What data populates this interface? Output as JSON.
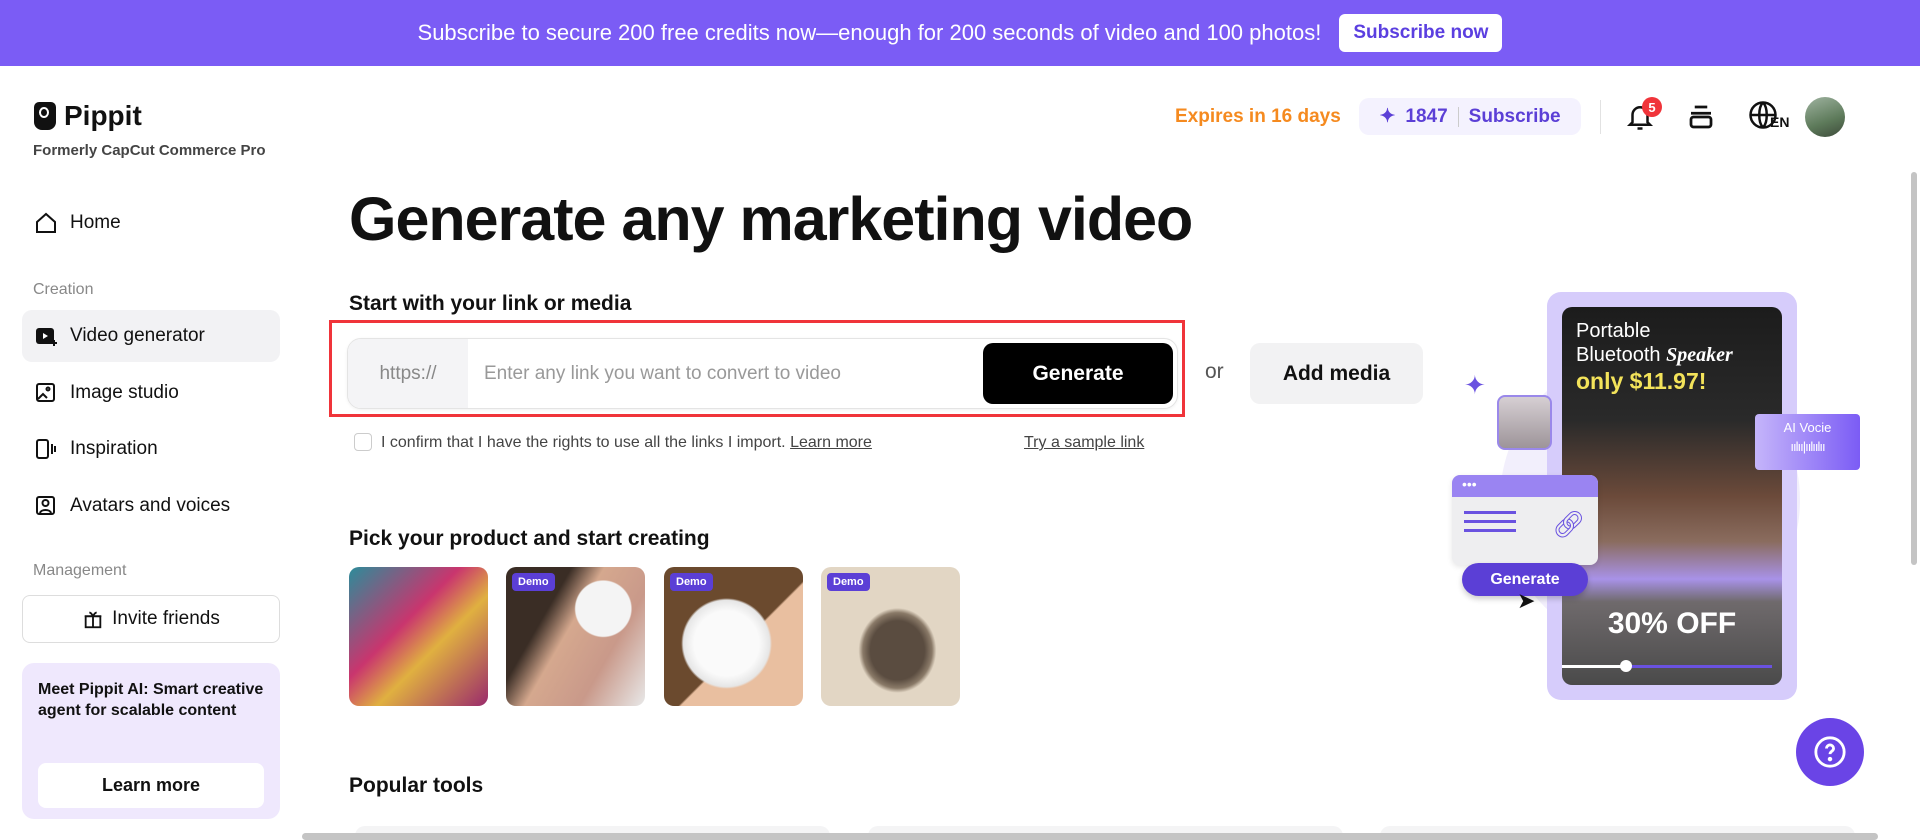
{
  "banner": {
    "text": "Subscribe to secure 200 free credits now—enough for 200 seconds of video and 100 photos!",
    "button": "Subscribe now"
  },
  "brand": {
    "name": "Pippit",
    "subtitle": "Formerly CapCut Commerce Pro"
  },
  "header": {
    "expires": "Expires in 16 days",
    "credits": "1847",
    "subscribe": "Subscribe",
    "notifications": "5",
    "language": "EN"
  },
  "sidebar": {
    "home": "Home",
    "creation_label": "Creation",
    "items": [
      {
        "label": "Video generator"
      },
      {
        "label": "Image studio"
      },
      {
        "label": "Inspiration"
      },
      {
        "label": "Avatars and voices"
      }
    ],
    "management_label": "Management",
    "invite": "Invite friends",
    "promo": {
      "text": "Meet Pippit AI: Smart creative agent for scalable content",
      "button": "Learn more"
    }
  },
  "main": {
    "title": "Generate any marketing video",
    "link_section": "Start with your link or media",
    "prefix": "https://",
    "placeholder": "Enter any link you want to convert to video",
    "generate": "Generate",
    "or": "or",
    "add_media": "Add media",
    "confirm": "I confirm that I have the rights to use all the links I import.",
    "learn_more": "Learn more",
    "sample": "Try a sample link",
    "pick_title": "Pick your product and start creating",
    "demo_badge": "Demo",
    "popular": "Popular tools"
  },
  "promo_art": {
    "line1": "Portable",
    "line2": "Bluetooth",
    "line2b": "Speaker",
    "price": "only $11.97!",
    "ai_voice": "AI Vocie",
    "generate": "Generate",
    "discount": "30% OFF"
  },
  "colors": {
    "accent": "#7b5cf5",
    "orange": "#f58a1f",
    "red": "#f0343a"
  }
}
